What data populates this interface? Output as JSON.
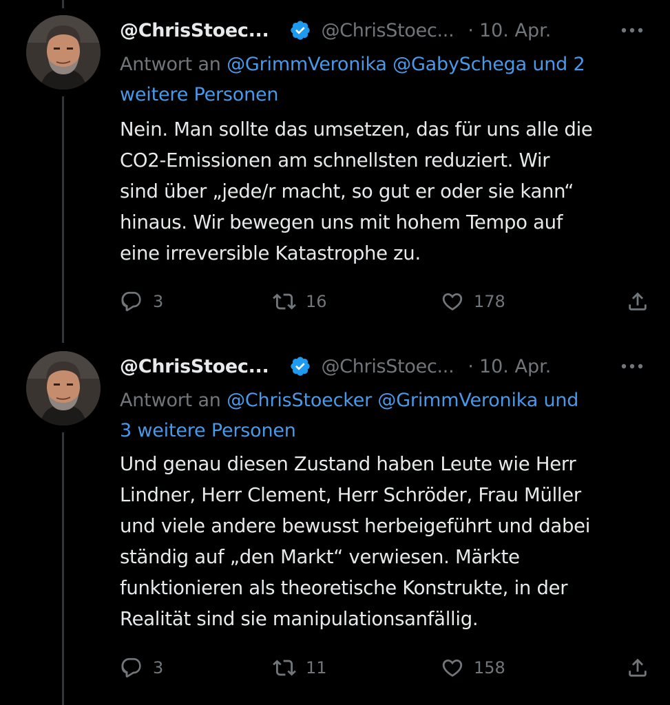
{
  "colors": {
    "background": "#000000",
    "text": "#e7e9ea",
    "muted": "#71767b",
    "link": "#4a99e9",
    "verified": "#1d9bf0",
    "thread_line": "#333639"
  },
  "tweets": [
    {
      "display_name": "@ChrisStoec...",
      "verified_icon": "verified-badge-icon",
      "handle": "@ChrisStoec...",
      "separator": "·",
      "date": "10. Apr.",
      "more_icon": "more-options-icon",
      "reply_prefix": "Antwort an",
      "reply_links": [
        "@GrimmVeronika",
        "@GabySchega",
        "und 2"
      ],
      "reply_links_line2": "weitere Personen",
      "body_lines": [
        "Nein. Man sollte das umsetzen, das für uns alle die",
        "CO2-Emissionen am schnellsten reduziert. Wir",
        "sind über „jede/r macht, so gut er oder sie kann“",
        "hinaus. Wir bewegen uns mit hohem Tempo auf",
        "eine irreversible Katastrophe zu."
      ],
      "replies": "3",
      "retweets": "16",
      "likes": "178",
      "share_icon": "share-icon"
    },
    {
      "display_name": "@ChrisStoec...",
      "verified_icon": "verified-badge-icon",
      "handle": "@ChrisStoec...",
      "separator": "·",
      "date": "10. Apr.",
      "more_icon": "more-options-icon",
      "reply_prefix": "Antwort an",
      "reply_links": [
        "@ChrisStoecker",
        "@GrimmVeronika",
        "und"
      ],
      "reply_links_line2": "3 weitere Personen",
      "body_lines": [
        "Und genau diesen Zustand haben Leute wie Herr",
        "Lindner, Herr Clement, Herr Schröder, Frau Müller",
        "und viele andere bewusst herbeigeführt und dabei",
        "ständig auf „den Markt“ verwiesen. Märkte",
        "funktionieren als theoretische Konstrukte, in der",
        "Realität sind sie manipulationsanfällig."
      ],
      "replies": "3",
      "retweets": "11",
      "likes": "158",
      "share_icon": "share-icon"
    }
  ]
}
